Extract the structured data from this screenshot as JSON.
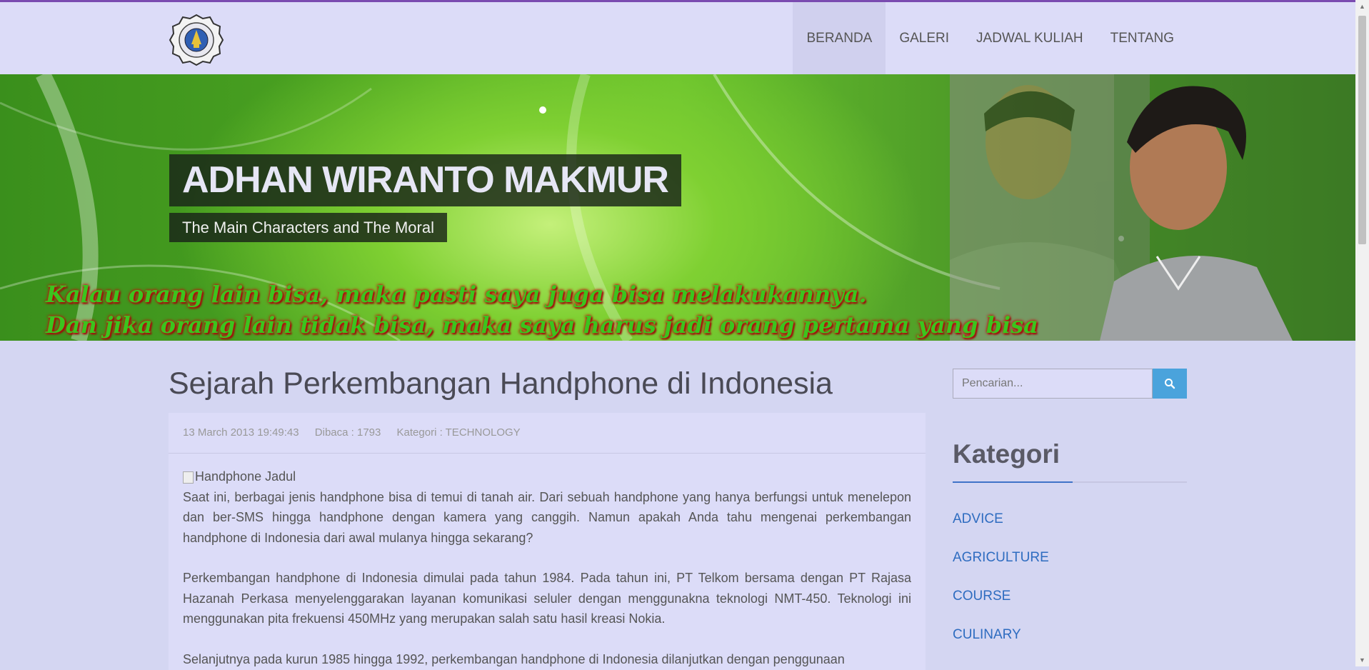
{
  "nav": {
    "items": [
      {
        "label": "BERANDA",
        "active": true
      },
      {
        "label": "GALERI",
        "active": false
      },
      {
        "label": "JADWAL KULIAH",
        "active": false
      },
      {
        "label": "TENTANG",
        "active": false
      }
    ]
  },
  "hero": {
    "title": "ADHAN WIRANTO MAKMUR",
    "subtitle": "The Main Characters and The Moral",
    "quote_line1": "Kalau orang lain bisa, maka pasti saya juga bisa melakukannya.",
    "quote_line2": "Dan jika orang lain tidak bisa, maka saya harus jadi orang pertama yang bisa"
  },
  "post": {
    "title": "Sejarah Perkembangan Handphone di Indonesia",
    "date": "13 March 2013 19:49:43",
    "views": "Dibaca : 1793",
    "category": "Kategori : TECHNOLOGY",
    "image_alt": "Handphone Jadul",
    "paragraphs": [
      "Saat ini, berbagai jenis handphone bisa di temui di tanah air. Dari sebuah handphone yang hanya berfungsi untuk menelepon dan ber-SMS hingga handphone dengan kamera yang canggih. Namun apakah Anda tahu mengenai perkembangan handphone di Indonesia dari awal mulanya hingga sekarang?",
      "Perkembangan handphone di Indonesia dimulai pada tahun 1984. Pada tahun ini, PT Telkom bersama dengan PT Rajasa Hazanah Perkasa menyelenggarakan layanan komunikasi seluler dengan menggunakna teknologi NMT-450. Teknologi ini menggunakan pita frekuensi 450MHz yang merupakan salah satu hasil kreasi Nokia.",
      "Selanjutnya pada kurun 1985 hingga 1992, perkembangan handphone di Indonesia dilanjutkan dengan penggunaan"
    ]
  },
  "sidebar": {
    "search_placeholder": "Pencarian...",
    "heading": "Kategori",
    "categories": [
      "ADVICE",
      "AGRICULTURE",
      "COURSE",
      "CULINARY"
    ]
  },
  "colors": {
    "background": "#d4d6f2",
    "navbar": "#dcdcf8",
    "accent": "#7a4bb0",
    "link": "#2e6cc0",
    "search_button": "#4aa3dc"
  }
}
